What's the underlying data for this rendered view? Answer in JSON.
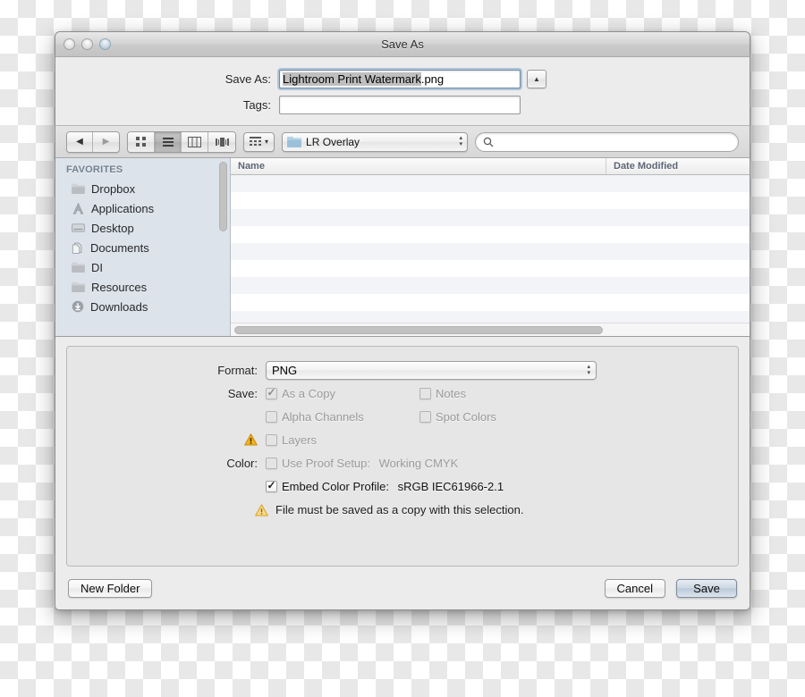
{
  "window": {
    "title": "Save As",
    "traffic_lights": [
      "close-button",
      "minimize-button",
      "zoom-button"
    ]
  },
  "name_area": {
    "save_as_label": "Save As:",
    "filename_selected": "Lightroom Print Watermark",
    "filename_extension": ".png",
    "filename_full": "Lightroom Print Watermark.png",
    "disclosure_glyph": "▲",
    "tags_label": "Tags:",
    "tags_value": "",
    "tags_placeholder": ""
  },
  "toolbar": {
    "back_glyph": "◀",
    "forward_glyph": "▶",
    "view_modes": [
      "icon-view",
      "list-view",
      "column-view",
      "coverflow-view"
    ],
    "active_view_mode": "list-view",
    "arrange_glyph": "▾",
    "location": "LR Overlay",
    "stepper_up": "▴",
    "stepper_down": "▾",
    "search_value": "",
    "search_placeholder": ""
  },
  "sidebar": {
    "header": "FAVORITES",
    "items": [
      {
        "label": "Dropbox",
        "icon": "folder-icon"
      },
      {
        "label": "Applications",
        "icon": "applications-icon"
      },
      {
        "label": "Desktop",
        "icon": "desktop-icon"
      },
      {
        "label": "Documents",
        "icon": "documents-icon"
      },
      {
        "label": "DI",
        "icon": "folder-icon"
      },
      {
        "label": "Resources",
        "icon": "folder-icon"
      },
      {
        "label": "Downloads",
        "icon": "downloads-icon"
      }
    ]
  },
  "filelist": {
    "columns": [
      "Name",
      "Date Modified"
    ],
    "rows": []
  },
  "options": {
    "format_label": "Format:",
    "format_value": "PNG",
    "save_label": "Save:",
    "color_label": "Color:",
    "checkboxes": [
      {
        "label": "As a Copy",
        "checked": true,
        "enabled": false
      },
      {
        "label": "Notes",
        "checked": false,
        "enabled": false
      },
      {
        "label": "Alpha Channels",
        "checked": false,
        "enabled": false
      },
      {
        "label": "Spot Colors",
        "checked": false,
        "enabled": false
      },
      {
        "label": "Layers",
        "checked": false,
        "enabled": false,
        "warning": true
      }
    ],
    "proof_setup": {
      "label": "Use Proof Setup:",
      "value": "Working CMYK",
      "checked": false,
      "enabled": false
    },
    "embed_profile": {
      "label": "Embed Color Profile:",
      "value": "sRGB IEC61966-2.1",
      "checked": true,
      "enabled": true
    },
    "warning_note": "File must be saved as a copy with this selection.",
    "warning_color": "#f2b31c"
  },
  "footer": {
    "new_folder_label": "New Folder",
    "cancel_label": "Cancel",
    "save_label": "Save"
  }
}
